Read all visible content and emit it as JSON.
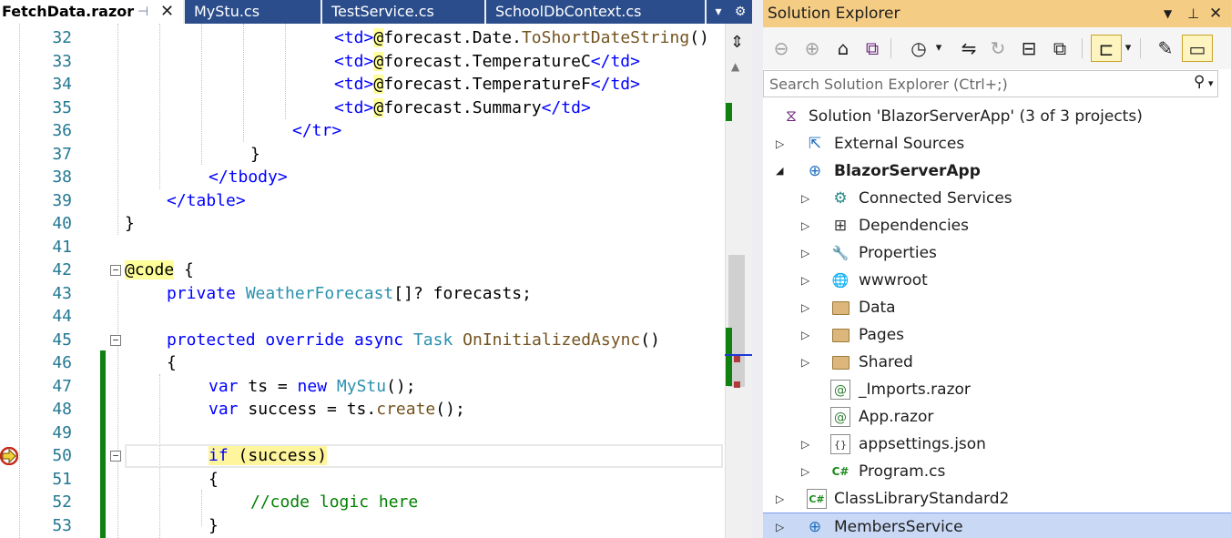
{
  "editor": {
    "tabs": [
      {
        "label": "FetchData.razor",
        "active": true
      },
      {
        "label": "MyStu.cs",
        "active": false
      },
      {
        "label": "TestService.cs",
        "active": false
      },
      {
        "label": "SchoolDbContext.cs",
        "active": false
      }
    ],
    "pin_glyph": "⊣",
    "close_glyph": "✕",
    "tab_overflow_glyph": "▾",
    "tab_settings_glyph": "⚙",
    "line_numbers": [
      "32",
      "33",
      "34",
      "35",
      "36",
      "37",
      "38",
      "39",
      "40",
      "41",
      "42",
      "43",
      "44",
      "45",
      "46",
      "47",
      "48",
      "49",
      "50",
      "51",
      "52",
      "53"
    ],
    "code": {
      "l32": {
        "a": "<td>",
        "at": "@",
        "b": "forecast",
        "c": ".",
        "d": "Date",
        "e": ".",
        "f": "ToShortDateString",
        "g": "()"
      },
      "l33": {
        "a": "<td>",
        "at": "@",
        "b": "forecast.TemperatureC",
        "t": "</td>"
      },
      "l34": {
        "a": "<td>",
        "at": "@",
        "b": "forecast.TemperatureF",
        "t": "</td>"
      },
      "l35": {
        "a": "<td>",
        "at": "@",
        "b": "forecast.Summary",
        "t": "</td>"
      },
      "l36": {
        "a": "</tr>"
      },
      "l37": {
        "a": "}"
      },
      "l38": {
        "a": "</tbody>"
      },
      "l39": {
        "a": "</table>"
      },
      "l40": {
        "a": "}"
      },
      "l42": {
        "a": "@code",
        "b": " {"
      },
      "l43": {
        "kw": "private",
        "type": "WeatherForecast",
        "rest": "[]? forecasts;"
      },
      "l45": {
        "kw1": "protected",
        "kw2": "override",
        "kw3": "async",
        "type": "Task",
        "meth": "OnInitializedAsync",
        "rest": "()"
      },
      "l46": {
        "a": "{"
      },
      "l47": {
        "kw": "var",
        "b": " ts = ",
        "kw2": "new",
        "type": "MyStu",
        "rest": "();"
      },
      "l48": {
        "kw": "var",
        "b": " success = ts.",
        "meth": "create",
        "rest": "();"
      },
      "l50": {
        "kw": "if",
        "rest": " (success)"
      },
      "l51": {
        "a": "{"
      },
      "l52": {
        "cmt": "//code logic here"
      },
      "l53": {
        "a": "}"
      }
    },
    "split_glyph": "⇕",
    "scroll_up_glyph": "▲"
  },
  "solution_explorer": {
    "title": "Solution Explorer",
    "title_controls": {
      "dropdown": "▼",
      "pin": "⊥",
      "close": "✕"
    },
    "toolbar": {
      "back": "⊖",
      "forward": "⊕",
      "home": "⌂",
      "switch_views": "⧉",
      "pending_changes": "◷",
      "pending_drop": "▾",
      "sync": "⇋",
      "refresh": "↻",
      "collapse_all": "⊟",
      "show_all_files": "⧉",
      "preview": "⊏",
      "preview_drop": "▾",
      "properties": "✎",
      "pending_toggle": "▭"
    },
    "search_placeholder": "Search Solution Explorer (Ctrl+;)",
    "search_icon_glyph": "⚲",
    "search_drop_glyph": "▾",
    "tree": [
      {
        "label": "Solution 'BlazorServerApp' (3 of 3 projects)",
        "expander": "",
        "icon": "solution-icon"
      },
      {
        "label": "External Sources",
        "expander": "▷",
        "icon": "external-sources-icon"
      },
      {
        "label": "BlazorServerApp",
        "expander": "◢",
        "icon": "web-project-icon",
        "bold": true
      },
      {
        "label": "Connected Services",
        "expander": "▷",
        "icon": "connected-services-icon"
      },
      {
        "label": "Dependencies",
        "expander": "▷",
        "icon": "dependencies-icon"
      },
      {
        "label": "Properties",
        "expander": "▷",
        "icon": "wrench-icon"
      },
      {
        "label": "wwwroot",
        "expander": "▷",
        "icon": "globe-icon"
      },
      {
        "label": "Data",
        "expander": "▷",
        "icon": "folder-icon"
      },
      {
        "label": "Pages",
        "expander": "▷",
        "icon": "folder-icon"
      },
      {
        "label": "Shared",
        "expander": "▷",
        "icon": "folder-icon"
      },
      {
        "label": "_Imports.razor",
        "expander": "",
        "icon": "razor-file-icon"
      },
      {
        "label": "App.razor",
        "expander": "",
        "icon": "razor-file-icon"
      },
      {
        "label": "appsettings.json",
        "expander": "▷",
        "icon": "json-file-icon"
      },
      {
        "label": "Program.cs",
        "expander": "▷",
        "icon": "csharp-file-icon"
      },
      {
        "label": "ClassLibraryStandard2",
        "expander": "▷",
        "icon": "csharp-project-icon"
      },
      {
        "label": "MembersService",
        "expander": "▷",
        "icon": "web-project-icon",
        "selected": true
      }
    ],
    "icon_glyphs": {
      "at": "@",
      "json": "{}",
      "csharp": "C#",
      "globe": "🌐",
      "wrench": "🔧",
      "deps": "⊞",
      "connected": "⚙",
      "external": "⇱",
      "web": "⊕",
      "solution": "⧖"
    }
  },
  "colors": {
    "accent_tab": "#2b4d8c",
    "solution_explorer_title": "#f5cc84",
    "selection": "#c9d8f5",
    "keyword": "#0000ff",
    "type": "#2b91af",
    "comment": "#008000",
    "change_bar": "#108010"
  }
}
